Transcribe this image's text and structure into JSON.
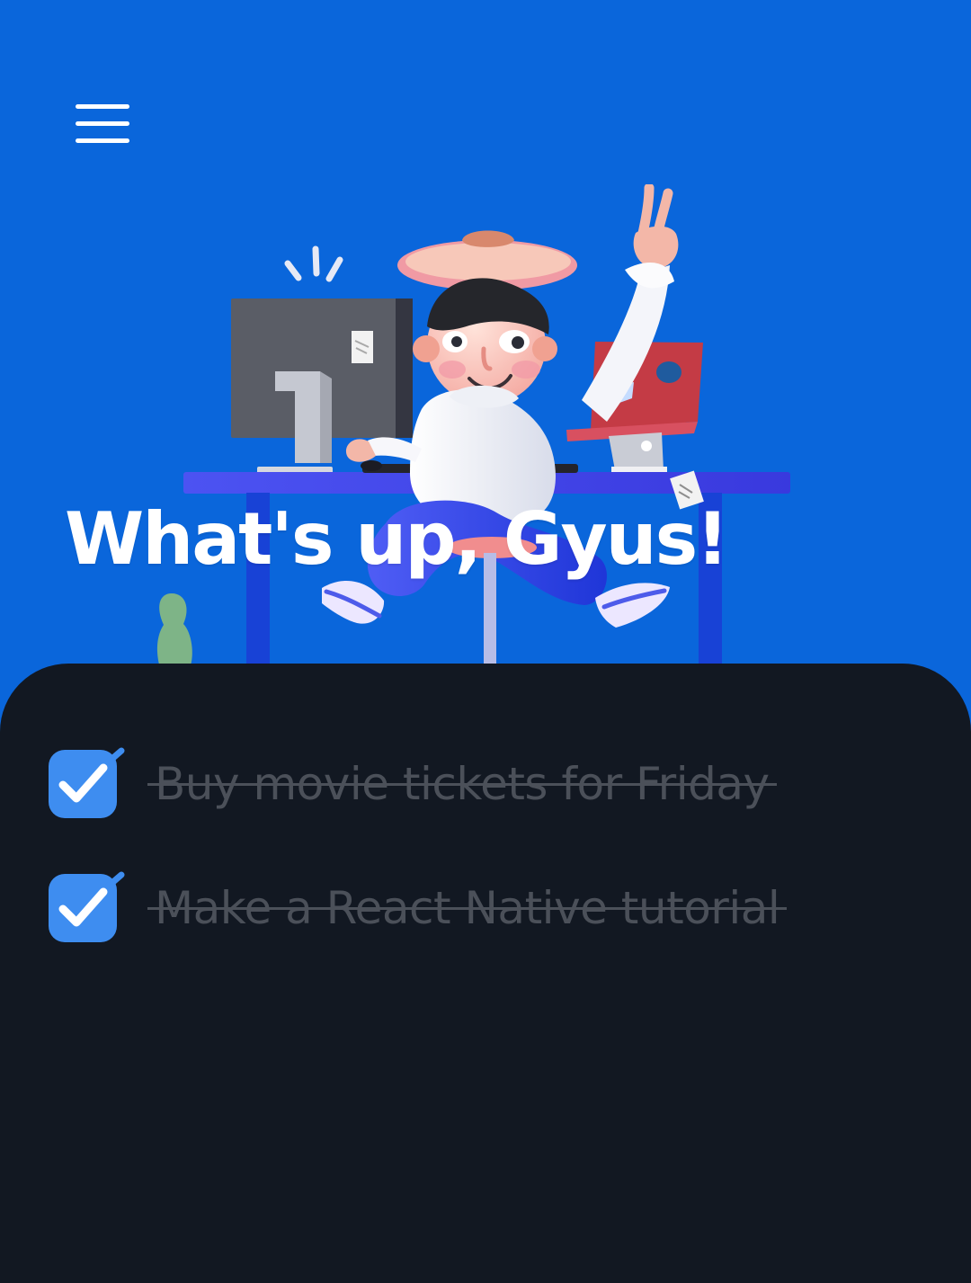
{
  "header": {
    "menu_icon": "hamburger-menu-icon",
    "greeting": "What's up, Gyus!"
  },
  "tasks": [
    {
      "label": "Buy movie tickets for Friday",
      "completed": true
    },
    {
      "label": "Make a React Native tutorial",
      "completed": true
    }
  ],
  "colors": {
    "hero_background": "#0a66db",
    "sheet_background": "#121822",
    "checkbox": "#3e8df0",
    "completed_text": "#4b5059",
    "greeting_text": "#ffffff"
  }
}
